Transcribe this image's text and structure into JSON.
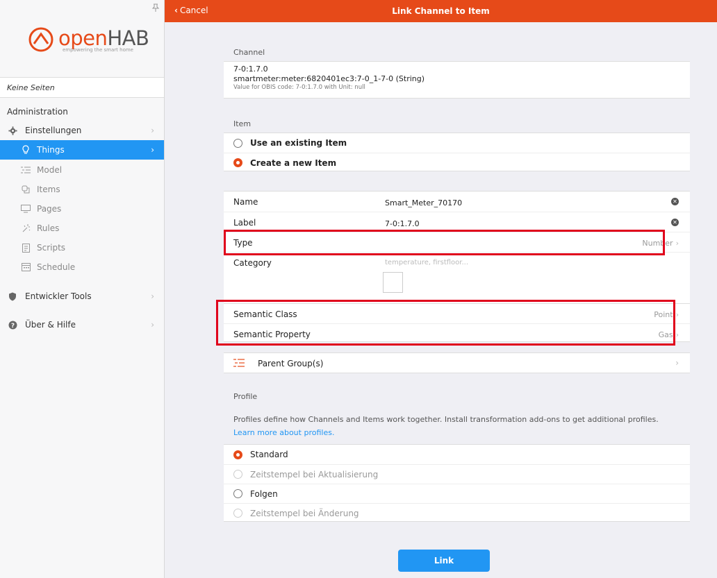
{
  "sidebar": {
    "logo_main": "open",
    "logo_hab": "HAB",
    "logo_tagline": "empowering the smart home",
    "no_pages": "Keine Seiten",
    "admin_title": "Administration",
    "settings": "Einstellungen",
    "sub_items": [
      "Things",
      "Model",
      "Items",
      "Pages",
      "Rules",
      "Scripts",
      "Schedule"
    ],
    "dev_tools": "Entwickler Tools",
    "help": "Über & Hilfe"
  },
  "topbar": {
    "cancel": "Cancel",
    "title": "Link Channel to Item"
  },
  "channel": {
    "section_title": "Channel",
    "id": "7-0:1.7.0",
    "uid": "smartmeter:meter:6820401ec3:7-0_1-7-0 (String)",
    "description": "Value for OBIS code: 7-0:1.7.0 with Unit: null"
  },
  "item": {
    "section_title": "Item",
    "options": [
      "Use an existing Item",
      "Create a new Item"
    ],
    "selected": "Create a new Item"
  },
  "fields": {
    "name_label": "Name",
    "name_value": "Smart_Meter_70170",
    "label_label": "Label",
    "label_value": "7-0:1.7.0",
    "type_label": "Type",
    "type_value": "Number",
    "category_label": "Category",
    "category_placeholder": "temperature, firstfloor..."
  },
  "semantic": {
    "class_label": "Semantic Class",
    "class_value": "Point",
    "property_label": "Semantic Property",
    "property_value": "Gas"
  },
  "parent": {
    "label": "Parent Group(s)"
  },
  "profile": {
    "section_title": "Profile",
    "description": "Profiles define how Channels and Items work together. Install transformation add-ons to get additional profiles.",
    "link": "Learn more about profiles.",
    "options": [
      "Standard",
      "Zeitstempel bei Aktualisierung",
      "Folgen",
      "Zeitstempel bei Änderung"
    ],
    "selected": "Standard"
  },
  "actions": {
    "link": "Link"
  },
  "colors": {
    "accent": "#e64a19",
    "primary": "#2196f3",
    "highlight": "#e0001b"
  }
}
